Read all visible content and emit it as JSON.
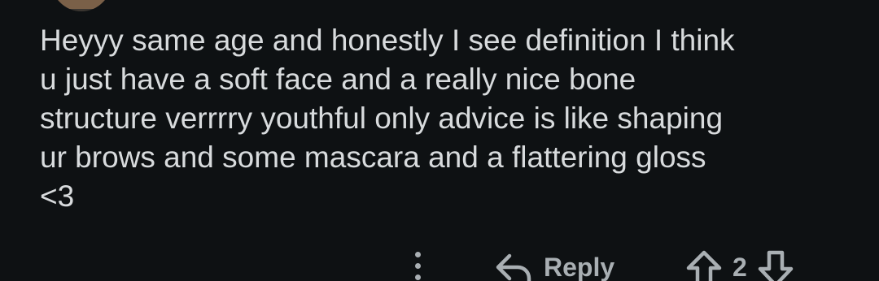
{
  "comment": {
    "text": "Heyyy same age and honestly I see definition I think\nu just have a soft face and a really nice bone\nstructure verrrry youthful only advice is like shaping\nur brows and some mascara and a flattering gloss\n<3"
  },
  "actions": {
    "more_icon": "more-vertical-icon",
    "reply_icon": "reply-arrow-icon",
    "reply_label": "Reply",
    "upvote_icon": "upvote-arrow-icon",
    "score": "2",
    "downvote_icon": "downvote-arrow-icon"
  },
  "colors": {
    "background": "#0e1113",
    "text": "#d8dbdd",
    "muted": "#a9afb3"
  }
}
